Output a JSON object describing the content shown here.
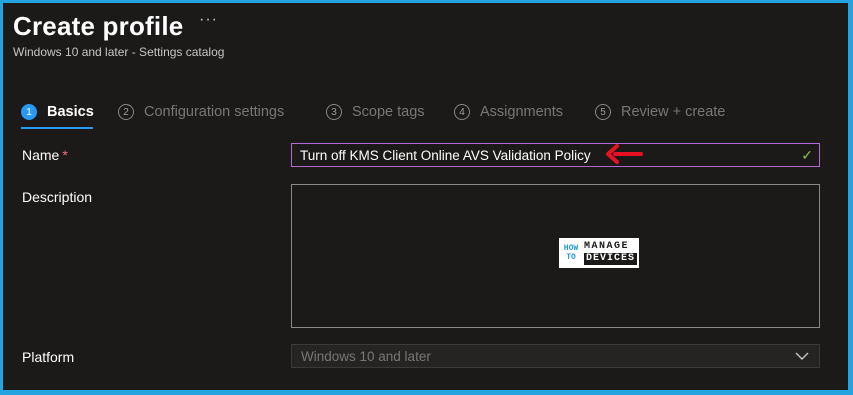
{
  "header": {
    "title": "Create profile",
    "more": "···",
    "subtitle": "Windows 10 and later - Settings catalog"
  },
  "steps": [
    {
      "number": "1",
      "label": "Basics",
      "active": true
    },
    {
      "number": "2",
      "label": "Configuration settings",
      "active": false
    },
    {
      "number": "3",
      "label": "Scope tags",
      "active": false
    },
    {
      "number": "4",
      "label": "Assignments",
      "active": false
    },
    {
      "number": "5",
      "label": "Review + create",
      "active": false
    }
  ],
  "form": {
    "name_label": "Name",
    "required_marker": "*",
    "name_value": "Turn off KMS Client Online AVS Validation Policy",
    "description_label": "Description",
    "description_value": "",
    "platform_label": "Platform",
    "platform_value": "Windows 10 and later"
  },
  "watermark": {
    "how": "HOW TO",
    "manage": "MANAGE",
    "devices": "DEVICES"
  },
  "colors": {
    "frame_border": "#24a3e0",
    "background": "#1b1a19",
    "accent": "#2899f5",
    "name_border": "#b36ad8",
    "required": "#f1707b",
    "valid_check": "#92c353",
    "annotation_arrow": "#e81123"
  },
  "icons": {
    "valid": "checkmark-icon",
    "annotation": "red-arrow-icon",
    "dropdown": "chevron-down-icon"
  }
}
